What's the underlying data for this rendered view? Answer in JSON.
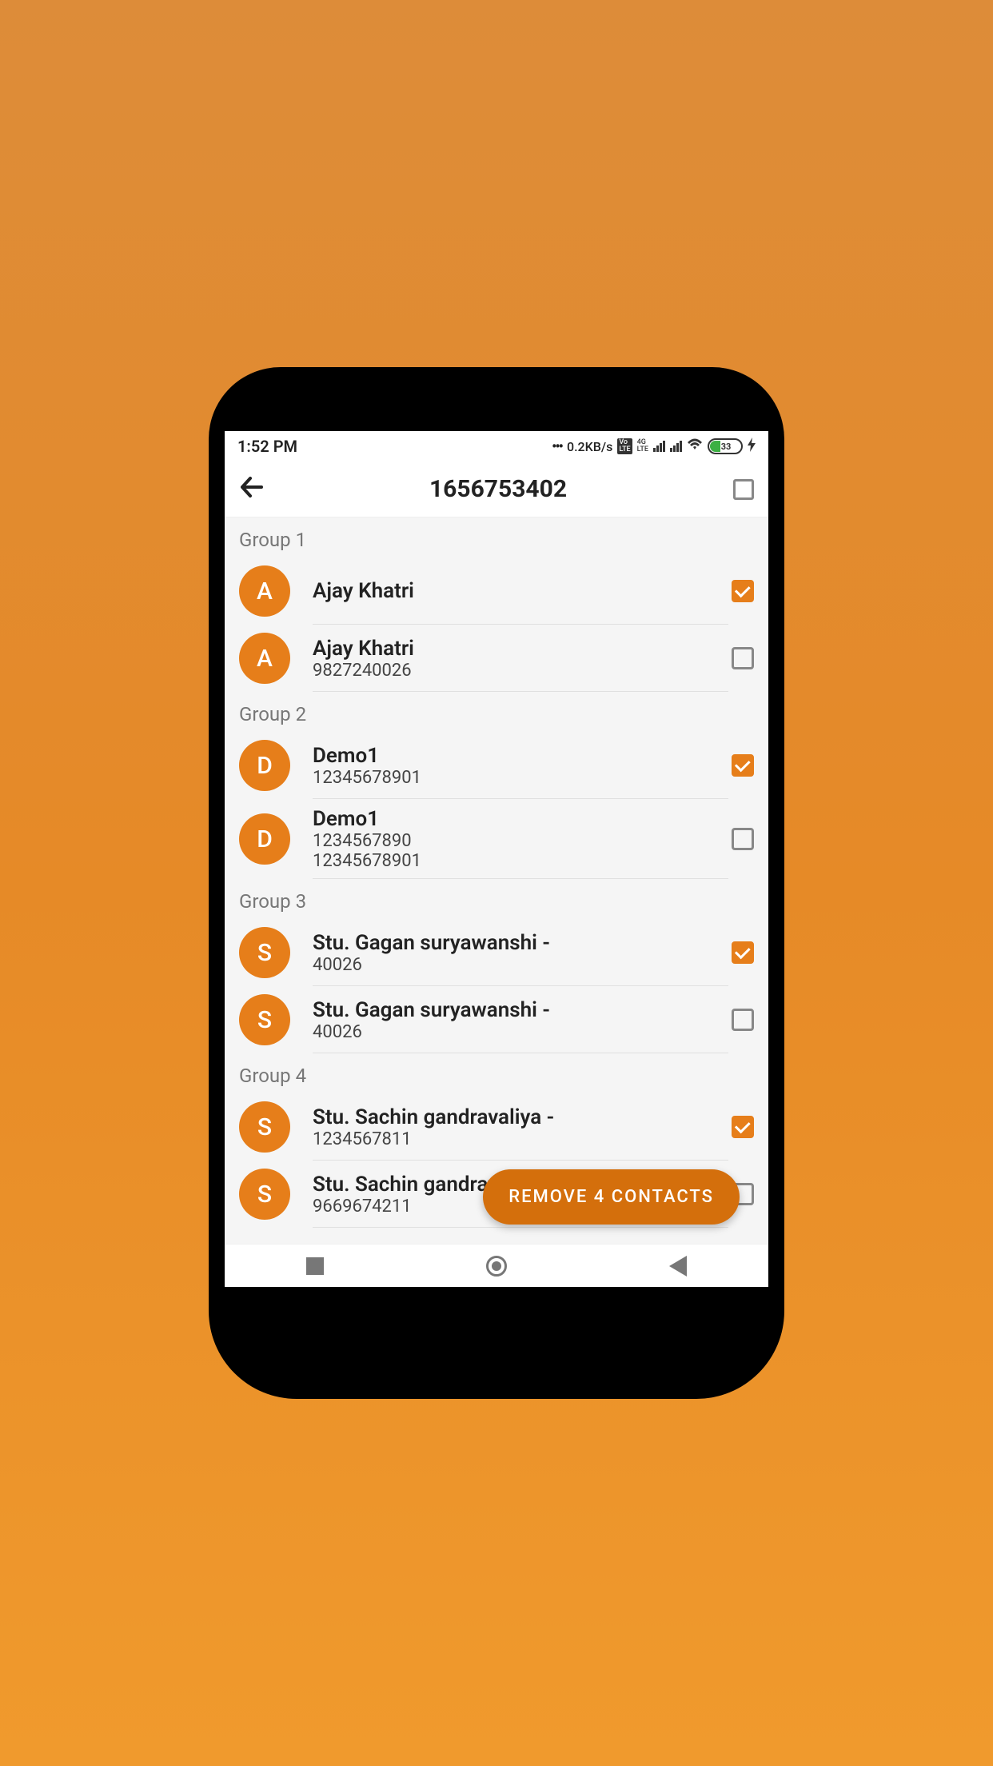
{
  "status": {
    "time": "1:52 PM",
    "speed": "0.2KB/s",
    "volte": "Vo\nLTE",
    "net4g": "4G\nLTE",
    "battery_pct": "33"
  },
  "header": {
    "title": "1656753402"
  },
  "fab": {
    "label": "REMOVE 4 CONTACTS"
  },
  "groups": [
    {
      "label": "Group 1",
      "contacts": [
        {
          "initial": "A",
          "name": "Ajay Khatri",
          "phone": "",
          "phone2": "",
          "checked": true
        },
        {
          "initial": "A",
          "name": "Ajay Khatri",
          "phone": "9827240026",
          "phone2": "",
          "checked": false
        }
      ]
    },
    {
      "label": "Group 2",
      "contacts": [
        {
          "initial": "D",
          "name": "Demo1",
          "phone": "12345678901",
          "phone2": "",
          "checked": true
        },
        {
          "initial": "D",
          "name": "Demo1",
          "phone": "1234567890",
          "phone2": "12345678901",
          "checked": false
        }
      ]
    },
    {
      "label": "Group 3",
      "contacts": [
        {
          "initial": "S",
          "name": "Stu. Gagan suryawanshi -",
          "phone": "40026",
          "phone2": "",
          "checked": true
        },
        {
          "initial": "S",
          "name": "Stu. Gagan suryawanshi -",
          "phone": "40026",
          "phone2": "",
          "checked": false
        }
      ]
    },
    {
      "label": "Group 4",
      "contacts": [
        {
          "initial": "S",
          "name": "Stu. Sachin gandravaliya  -",
          "phone": "1234567811",
          "phone2": "",
          "checked": true
        },
        {
          "initial": "S",
          "name": "Stu. Sachin gandravaliya  -",
          "phone": "9669674211",
          "phone2": "",
          "checked": false
        }
      ]
    }
  ]
}
